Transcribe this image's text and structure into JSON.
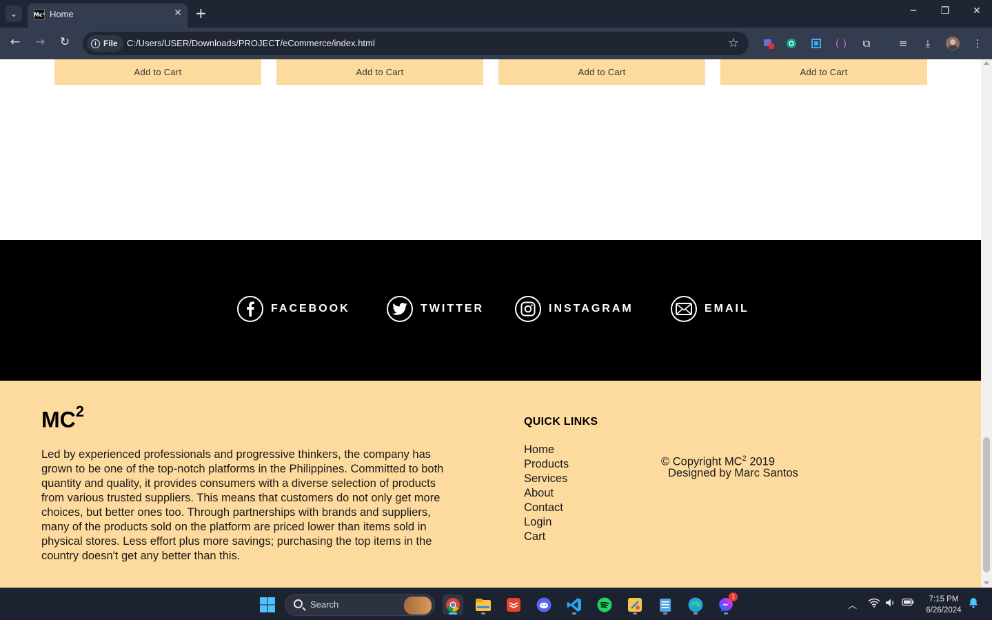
{
  "browser": {
    "tab_title": "Home",
    "favicon_text": "Mc²",
    "site_chip": "File",
    "url": "C:/Users/USER/Downloads/PROJECT/eCommerce/index.html"
  },
  "products": {
    "add_to_cart_labels": [
      "Add to Cart",
      "Add to Cart",
      "Add to Cart",
      "Add to Cart"
    ]
  },
  "social": {
    "items": [
      {
        "label": "FACEBOOK",
        "icon": "facebook-icon"
      },
      {
        "label": "TWITTER",
        "icon": "twitter-icon"
      },
      {
        "label": "INSTAGRAM",
        "icon": "instagram-icon"
      },
      {
        "label": "EMAIL",
        "icon": "email-icon"
      }
    ]
  },
  "footer": {
    "brand": "MC",
    "brand_sup": "2",
    "about": "Led by experienced professionals and progressive thinkers, the company has grown to be one of the top-notch platforms in the Philippines. Committed to both quantity and quality, it provides consumers with a diverse selection of products from various trusted suppliers. This means that customers do not only get more choices, but better ones too. Through partnerships with brands and suppliers, many of the products sold on the platform are priced lower than items sold in physical stores. Less effort plus more savings; purchasing the top items in the country doesn't get any better than this.",
    "quick_links_title": "QUICK LINKS",
    "quick_links": [
      "Home",
      "Products",
      "Services",
      "About",
      "Contact",
      "Login",
      "Cart"
    ],
    "copyright_pre": "© Copyright MC",
    "copyright_sup": "2",
    "copyright_post": " 2019",
    "designed_by": "Designed by Marc Santos"
  },
  "taskbar": {
    "search_placeholder": "Search",
    "time": "7:15 PM",
    "date": "6/26/2024",
    "messenger_badge": "1"
  },
  "colors": {
    "accent_peach": "#fddb9e",
    "social_bg": "#000000",
    "chrome_dark": "#1f2533"
  }
}
